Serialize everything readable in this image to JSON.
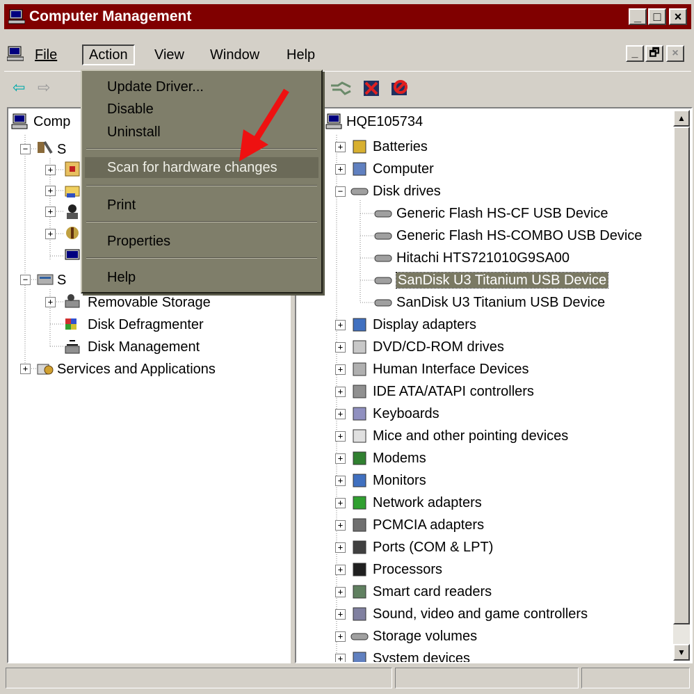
{
  "window": {
    "title": "Computer Management",
    "caption_buttons": [
      "_",
      "□",
      "×"
    ]
  },
  "menubar": {
    "items": [
      "File",
      "Action",
      "View",
      "Window",
      "Help"
    ],
    "mdi_buttons": [
      "_",
      "🗗",
      "×"
    ]
  },
  "context_menu": {
    "items": [
      {
        "label": "Update Driver..."
      },
      {
        "label": "Disable"
      },
      {
        "label": "Uninstall"
      },
      {
        "label": "Scan for hardware changes",
        "highlighted": true
      },
      {
        "label": "Print"
      },
      {
        "label": "Properties"
      },
      {
        "label": "Help"
      }
    ]
  },
  "left_tree": {
    "root": "Computer Management (Local)",
    "root_visible": "Comp",
    "system_tools_visible": "S",
    "storage_visible": "S",
    "storage_children": [
      "Removable Storage",
      "Disk Defragmenter",
      "Disk Management"
    ],
    "services": "Services and Applications"
  },
  "device_tree": {
    "root": "HQE105734",
    "nodes": [
      {
        "label": "Batteries",
        "icon": "battery-icon"
      },
      {
        "label": "Computer",
        "icon": "computer-icon"
      },
      {
        "label": "Disk drives",
        "icon": "disk-drive-icon",
        "expanded": true,
        "children": [
          "Generic Flash HS-CF USB Device",
          "Generic Flash HS-COMBO USB Device",
          "Hitachi HTS721010G9SA00",
          "SanDisk U3 Titanium USB Device",
          "SanDisk U3 Titanium USB Device"
        ],
        "selected_child": 3
      },
      {
        "label": "Display adapters",
        "icon": "monitor-icon"
      },
      {
        "label": "DVD/CD-ROM drives",
        "icon": "cdrom-icon"
      },
      {
        "label": "Human Interface Devices",
        "icon": "hid-icon"
      },
      {
        "label": "IDE ATA/ATAPI controllers",
        "icon": "ide-icon"
      },
      {
        "label": "Keyboards",
        "icon": "keyboard-icon"
      },
      {
        "label": "Mice and other pointing devices",
        "icon": "mouse-icon"
      },
      {
        "label": "Modems",
        "icon": "modem-icon"
      },
      {
        "label": "Monitors",
        "icon": "monitor-icon"
      },
      {
        "label": "Network adapters",
        "icon": "network-icon"
      },
      {
        "label": "PCMCIA adapters",
        "icon": "pcmcia-icon"
      },
      {
        "label": "Ports (COM & LPT)",
        "icon": "port-icon"
      },
      {
        "label": "Processors",
        "icon": "processor-icon"
      },
      {
        "label": "Smart card readers",
        "icon": "smartcard-icon"
      },
      {
        "label": "Sound, video and game controllers",
        "icon": "sound-icon"
      },
      {
        "label": "Storage volumes",
        "icon": "disk-drive-icon"
      },
      {
        "label": "System devices",
        "icon": "computer-icon"
      }
    ]
  },
  "colors": {
    "title_bar": "#800000",
    "menu_highlight": "#6b6a58",
    "selection": "#7a7963",
    "annotation_arrow": "#ee1111"
  }
}
